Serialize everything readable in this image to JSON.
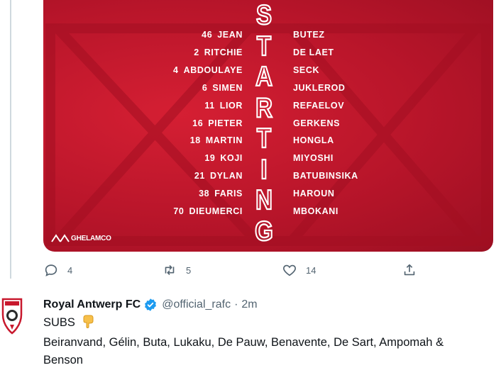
{
  "lineup": {
    "title_letters": [
      "S",
      "T",
      "A",
      "R",
      "T",
      "I",
      "N",
      "G"
    ],
    "sponsor": "GHELAMCO",
    "players": [
      {
        "number": "46",
        "first": "JEAN",
        "last": "BUTEZ"
      },
      {
        "number": "2",
        "first": "RITCHIE",
        "last": "DE LAET"
      },
      {
        "number": "4",
        "first": "ABDOULAYE",
        "last": "SECK"
      },
      {
        "number": "6",
        "first": "SIMEN",
        "last": "JUKLEROD"
      },
      {
        "number": "11",
        "first": "LIOR",
        "last": "REFAELOV"
      },
      {
        "number": "16",
        "first": "PIETER",
        "last": "GERKENS"
      },
      {
        "number": "18",
        "first": "MARTIN",
        "last": "HONGLA"
      },
      {
        "number": "19",
        "first": "KOJI",
        "last": "MIYOSHI"
      },
      {
        "number": "21",
        "first": "DYLAN",
        "last": "BATUBINSIKA"
      },
      {
        "number": "38",
        "first": "FARIS",
        "last": "HAROUN"
      },
      {
        "number": "70",
        "first": "DIEUMERCI",
        "last": "MBOKANI"
      }
    ],
    "colors": {
      "card_red": "#c8182d",
      "text": "#ffffff"
    }
  },
  "actions": {
    "reply": {
      "icon": "reply-icon",
      "count": "4"
    },
    "retweet": {
      "icon": "retweet-icon",
      "count": "5"
    },
    "like": {
      "icon": "heart-icon",
      "count": "14"
    },
    "share": {
      "icon": "share-icon"
    }
  },
  "tweet2": {
    "name": "Royal Antwerp FC",
    "handle": "@official_rafc",
    "separator": "·",
    "time": "2m",
    "line1": "SUBS",
    "line1_emoji": "pointing-down-emoji",
    "line2": "Beiranvand, Gélin, Buta, Lukaku, De Pauw, Benavente, De Sart, Ampomah &",
    "line3": "Benson",
    "colors": {
      "verified": "#1d9bf0",
      "muted": "#536471"
    }
  }
}
